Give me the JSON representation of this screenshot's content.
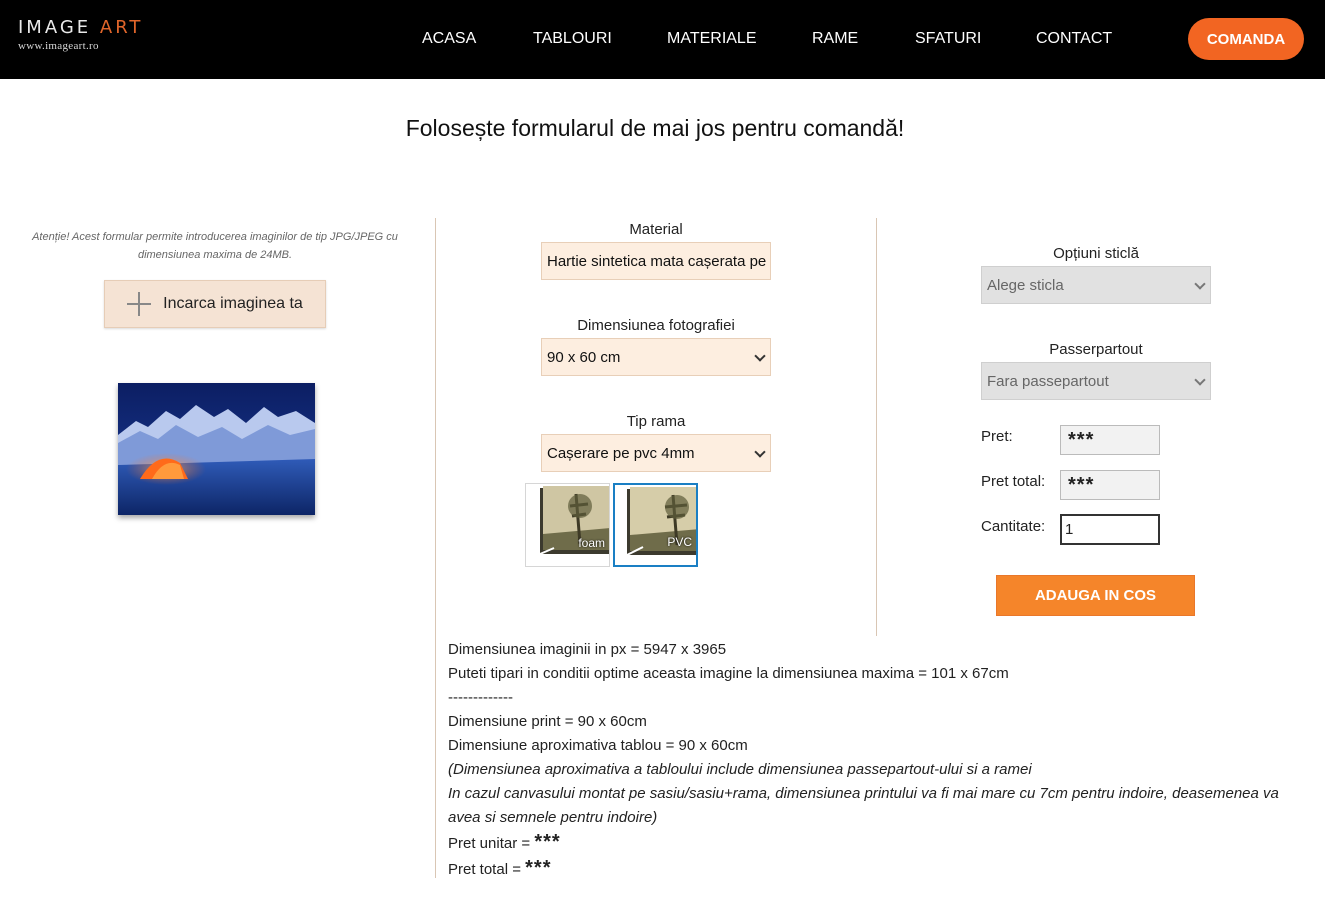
{
  "header": {
    "logo_left": "IMAGE",
    "logo_accent": "ART",
    "logo_url": "www.imageart.ro",
    "nav": [
      "ACASA",
      "TABLOURI",
      "MATERIALE",
      "RAME",
      "SFATURI",
      "CONTACT"
    ],
    "order_button": "COMANDA",
    "accent_color": "#f26522"
  },
  "page_title": "Folosește formularul de mai jos pentru comandă!",
  "left": {
    "notice": "Atenție! Acest formular permite introducerea imaginilor de tip JPG/JPEG cu dimensiunea maxima de 24MB.",
    "upload_button": "Incarca imaginea ta"
  },
  "middle": {
    "material_label": "Material",
    "material_value": "Hartie sintetica mata cașerata pe",
    "size_label": "Dimensiunea fotografiei",
    "size_value": "90 x 60 cm",
    "frame_label": "Tip rama",
    "frame_value": "Cașerare pe pvc 4mm",
    "thumbs": [
      {
        "label": "foam",
        "selected": false
      },
      {
        "label": "PVC",
        "selected": true
      }
    ]
  },
  "right": {
    "glass_label": "Opțiuni sticlă",
    "glass_value": "Alege sticla",
    "passe_label": "Passerpartout",
    "passe_value": "Fara passepartout",
    "price_label": "Pret:",
    "price_value": "***",
    "total_label": "Pret total:",
    "total_value": "***",
    "qty_label": "Cantitate:",
    "qty_value": "1",
    "add_cart": "ADAUGA IN COS"
  },
  "info": {
    "line1": "Dimensiunea imaginii in px = 5947 x 3965",
    "line2": "Puteti tipari in conditii optime aceasta imagine la dimensiunea maxima = 101 x 67cm",
    "line3": "-------------",
    "line4": "Dimensiune print = 90 x 60cm",
    "line5": "Dimensiune aproximativa tablou = 90 x 60cm",
    "line6": "(Dimensiunea aproximativa a tabloului include dimensiunea passepartout-ului si a ramei",
    "line7": "In cazul canvasului montat pe sasiu/sasiu+rama, dimensiunea printului va fi mai mare cu 7cm pentru indoire, deasemenea va avea si semnele pentru indoire)",
    "unit_label": "Pret unitar =",
    "unit_value": "***",
    "total_label": "Pret total =",
    "total_value": "***"
  }
}
